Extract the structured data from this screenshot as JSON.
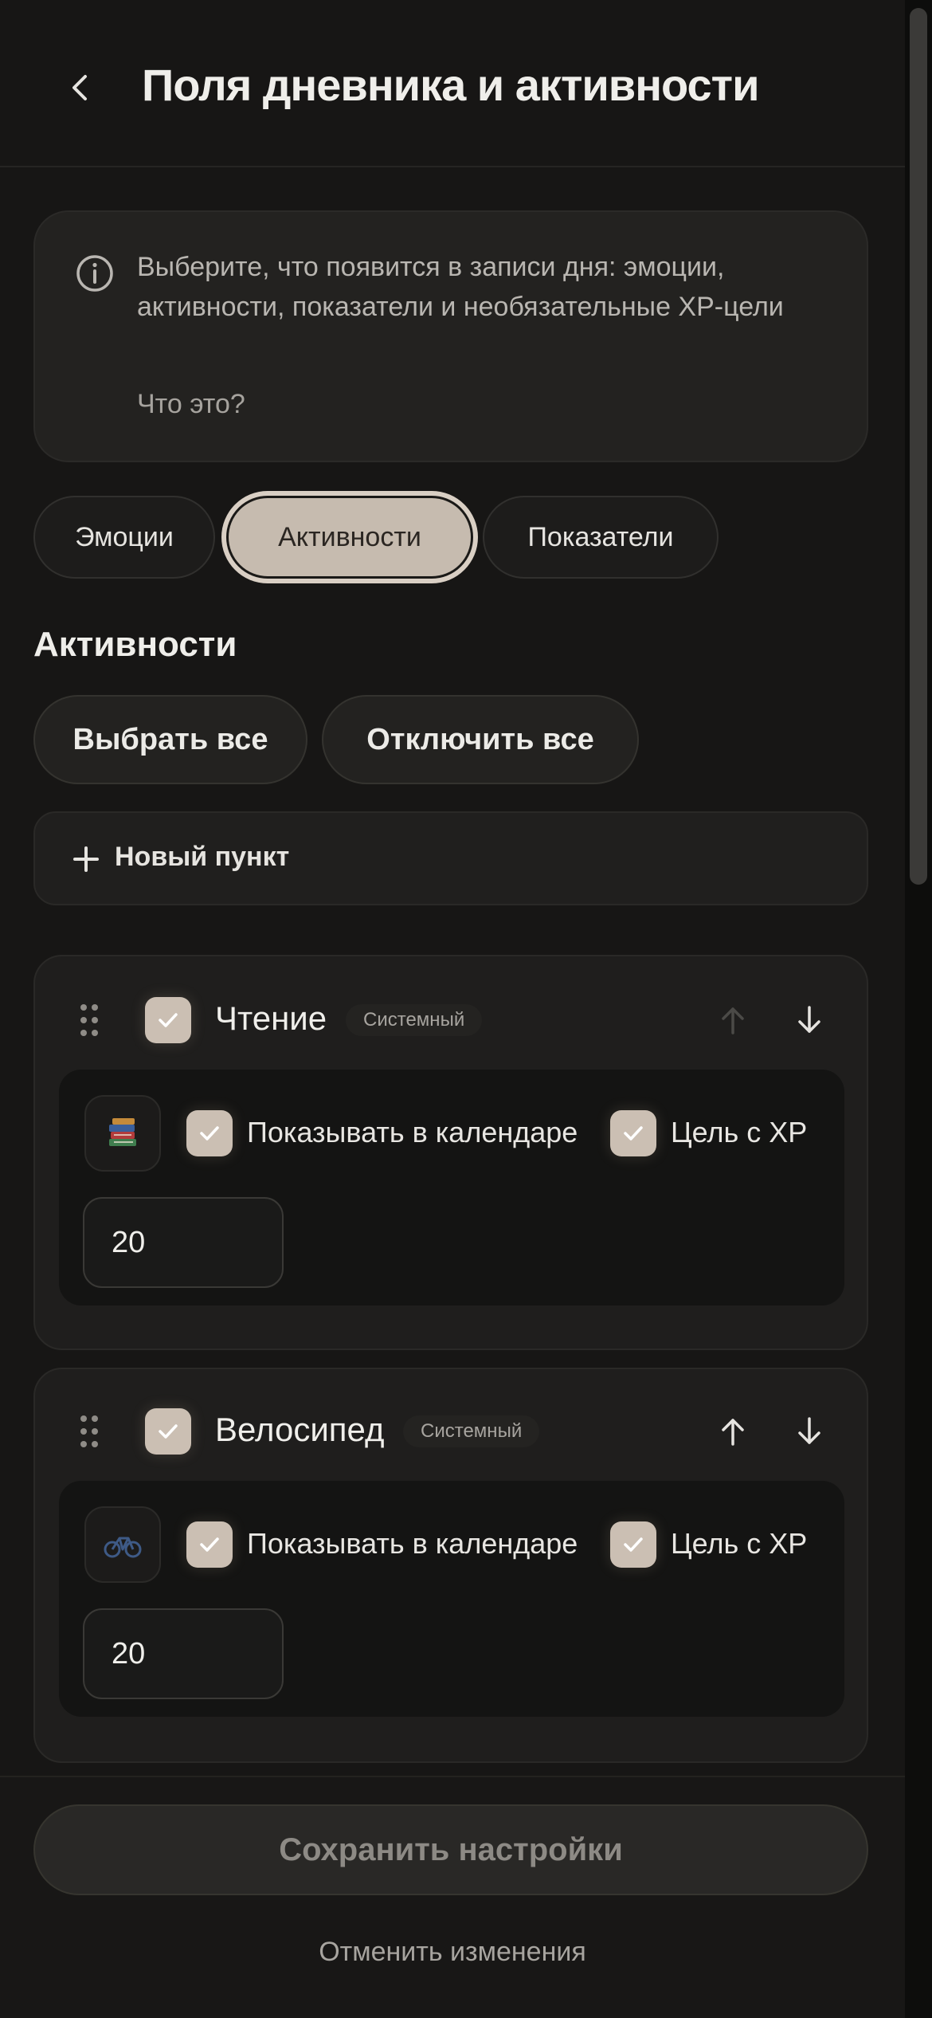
{
  "header": {
    "title": "Поля дневника и активности"
  },
  "info": {
    "text": "Выберите, что появится в записи дня: эмоции, активности, показатели и необязательные XP-цели",
    "link": "Что это?"
  },
  "tabs": [
    {
      "label": "Эмоции",
      "active": false
    },
    {
      "label": "Активности",
      "active": true
    },
    {
      "label": "Показатели",
      "active": false
    }
  ],
  "section": {
    "title": "Активности",
    "select_all": "Выбрать все",
    "disable_all": "Отключить все",
    "new_item": "Новый пункт"
  },
  "activities": [
    {
      "name": "Чтение",
      "badge": "Системный",
      "enabled": true,
      "icon": "books-emoji",
      "show_in_calendar_label": "Показывать в календаре",
      "show_in_calendar": true,
      "xp_goal_label": "Цель с XP",
      "xp_goal": true,
      "value": "20",
      "up_disabled": true
    },
    {
      "name": "Велосипед",
      "badge": "Системный",
      "enabled": true,
      "icon": "bicycle-emoji",
      "show_in_calendar_label": "Показывать в календаре",
      "show_in_calendar": true,
      "xp_goal_label": "Цель с XP",
      "xp_goal": true,
      "value": "20",
      "up_disabled": false
    }
  ],
  "footer": {
    "save": "Сохранить настройки",
    "cancel": "Отменить изменения"
  },
  "colors": {
    "accent": "#c6bbaf",
    "background": "#171615",
    "card": "#232220"
  }
}
